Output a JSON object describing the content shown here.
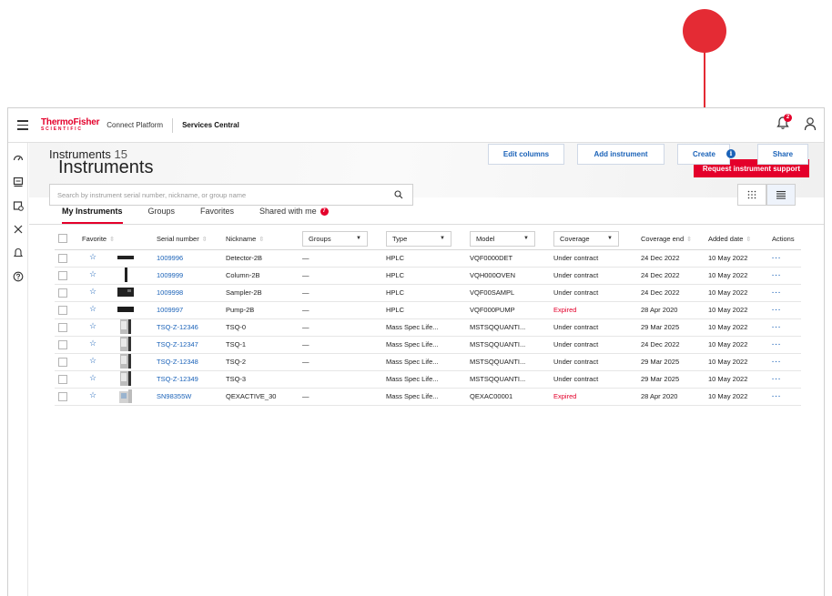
{
  "colors": {
    "accent": "#e4002b",
    "link": "#1a62b8",
    "annotation": "#e42b34"
  },
  "brand": {
    "logo_top": "ThermoFisher",
    "logo_bottom": "SCIENTIFIC",
    "platform": "Connect Platform",
    "section": "Services Central"
  },
  "topbar": {
    "notification_count": "2"
  },
  "page": {
    "title": "Instruments",
    "request_button": "Request instrument support"
  },
  "tabs": [
    {
      "label": "My Instruments"
    },
    {
      "label": "Groups"
    },
    {
      "label": "Favorites"
    },
    {
      "label": "Shared with me",
      "badge": "7"
    }
  ],
  "section": {
    "title": "Instruments",
    "count": "15"
  },
  "actions": {
    "edit_columns": "Edit columns",
    "add_instrument": "Add instrument",
    "create": "Create",
    "share": "Share"
  },
  "search": {
    "placeholder": "Search by instrument serial number, nickname, or group name"
  },
  "table": {
    "headers": {
      "favorite": "Favorite",
      "serial": "Serial number",
      "nickname": "Nickname",
      "groups": "Groups",
      "type": "Type",
      "model": "Model",
      "coverage": "Coverage",
      "coverage_end": "Coverage end",
      "added_date": "Added date",
      "actions": "Actions"
    },
    "rows": [
      {
        "serial": "1009996",
        "nickname": "Detector-2B",
        "groups": "—",
        "type": "HPLC",
        "model": "VQF0000DET",
        "coverage": "Under contract",
        "coverage_end": "24 Dec 2022",
        "added": "10 May 2022",
        "actions": "···",
        "thumb": "detector"
      },
      {
        "serial": "1009999",
        "nickname": "Column-2B",
        "groups": "—",
        "type": "HPLC",
        "model": "VQH000OVEN",
        "coverage": "Under contract",
        "coverage_end": "24 Dec 2022",
        "added": "10 May 2022",
        "actions": "···",
        "thumb": "column"
      },
      {
        "serial": "1009998",
        "nickname": "Sampler-2B",
        "groups": "—",
        "type": "HPLC",
        "model": "VQF00SAMPL",
        "coverage": "Under contract",
        "coverage_end": "24 Dec 2022",
        "added": "10 May 2022",
        "actions": "···",
        "thumb": "sampler"
      },
      {
        "serial": "1009997",
        "nickname": "Pump-2B",
        "groups": "—",
        "type": "HPLC",
        "model": "VQF000PUMP",
        "coverage": "Expired",
        "coverage_end": "28 Apr 2020",
        "added": "10 May 2022",
        "actions": "···",
        "thumb": "pump"
      },
      {
        "serial": "TSQ-Z-12346",
        "nickname": "TSQ-0",
        "groups": "—",
        "type": "Mass Spec Life...",
        "model": "MSTSQQUANTI...",
        "coverage": "Under contract",
        "coverage_end": "29 Mar 2025",
        "added": "10 May 2022",
        "actions": "···",
        "thumb": "tsq"
      },
      {
        "serial": "TSQ-Z-12347",
        "nickname": "TSQ-1",
        "groups": "—",
        "type": "Mass Spec Life...",
        "model": "MSTSQQUANTI...",
        "coverage": "Under contract",
        "coverage_end": "24 Dec 2022",
        "added": "10 May 2022",
        "actions": "···",
        "thumb": "tsq"
      },
      {
        "serial": "TSQ-Z-12348",
        "nickname": "TSQ-2",
        "groups": "—",
        "type": "Mass Spec Life...",
        "model": "MSTSQQUANTI...",
        "coverage": "Under contract",
        "coverage_end": "29 Mar 2025",
        "added": "10 May 2022",
        "actions": "···",
        "thumb": "tsq"
      },
      {
        "serial": "TSQ-Z-12349",
        "nickname": "TSQ-3",
        "groups": "",
        "type": "Mass Spec Life...",
        "model": "MSTSQQUANTI...",
        "coverage": "Under contract",
        "coverage_end": "29 Mar 2025",
        "added": "10 May 2022",
        "actions": "···",
        "thumb": "tsq"
      },
      {
        "serial": "SN98355W",
        "nickname": "QEXACTIVE_30",
        "groups": "—",
        "type": "Mass Spec Life...",
        "model": "QEXAC00001",
        "coverage": "Expired",
        "coverage_end": "28 Apr 2020",
        "added": "10 May 2022",
        "actions": "···",
        "thumb": "qexactive"
      }
    ]
  }
}
